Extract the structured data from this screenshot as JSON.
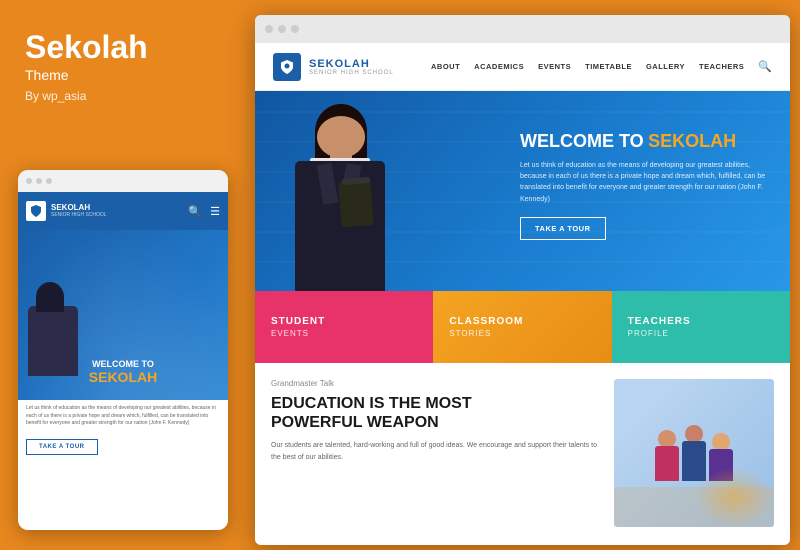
{
  "left": {
    "theme_name": "Sekolah",
    "theme_label": "Theme",
    "author": "By wp_asia"
  },
  "mobile": {
    "logo": "SEKOLAH",
    "logo_sub": "SENIOR HIGH SCHOOL",
    "welcome": "WELCOME TO",
    "sekolah": "SEKOLAH",
    "desc": "Let us think of education as the means of developing our greatest abilities, because in each of us there is a private hope and dream which, fulfilled, can be translated into benefit for everyone and greater strength for our nation (John F. Kennedy)",
    "take_tour": "TAKE A TOUR"
  },
  "desktop": {
    "logo": "SEKOLAH",
    "logo_sub": "SENIOR HIGH SCHOOL",
    "nav": {
      "items": [
        "ABOUT",
        "ACADEMICS",
        "EVENTS",
        "TIMETABLE",
        "GALLERY",
        "TEACHERS"
      ]
    },
    "hero": {
      "welcome": "WELCOME TO",
      "sekolah": "SEKOLAH",
      "desc": "Let us think of education as the means of developing our greatest abilities, because in each of us there is a private hope and dream which, fulfilled, can be translated into benefit for everyone and greater strength for our nation (John F. Kennedy)",
      "cta": "TAKE A TOUR"
    },
    "cards": [
      {
        "title": "STUDENT",
        "subtitle": "EVENTS"
      },
      {
        "title": "CLASSROOM",
        "subtitle": "STORIES"
      },
      {
        "title": "TEACHERS",
        "subtitle": "PROFILE"
      }
    ],
    "content": {
      "tag": "Grandmaster Talk",
      "heading_line1": "EDUCATION IS THE MOST",
      "heading_line2": "POWERFUL WEAPON",
      "body": "Our students are talented, hard-working and full of good ideas. We encourage and support their talents to the best of our abilities."
    }
  },
  "colors": {
    "orange": "#E8871E",
    "blue": "#1a5fa8",
    "pink": "#E8326A",
    "teal": "#2DBDAA",
    "amber": "#F5A623"
  }
}
